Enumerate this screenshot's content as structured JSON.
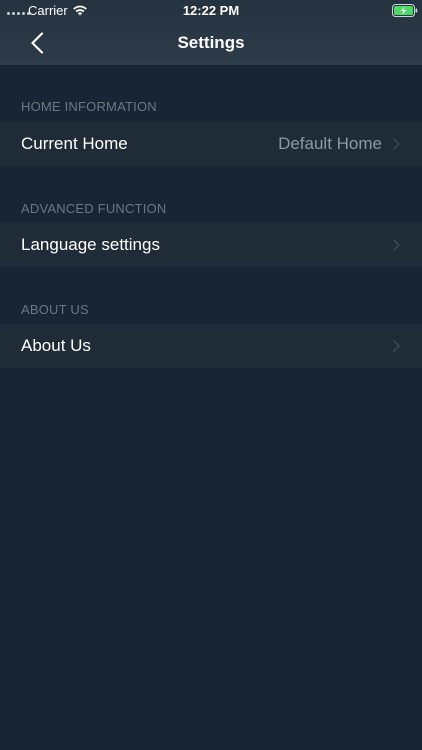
{
  "status_bar": {
    "carrier": "Carrier",
    "time": "12:22 PM",
    "signal_icon": "signal-dots-icon",
    "wifi_icon": "wifi-icon",
    "battery_icon": "battery-charging-icon",
    "battery_color": "#4cd964"
  },
  "nav_bar": {
    "title": "Settings",
    "back_icon": "chevron-left-icon"
  },
  "sections": [
    {
      "header": "HOME INFORMATION",
      "rows": [
        {
          "label": "Current Home",
          "value": "Default Home"
        }
      ]
    },
    {
      "header": "ADVANCED FUNCTION",
      "rows": [
        {
          "label": "Language settings",
          "value": ""
        }
      ]
    },
    {
      "header": "ABOUT US",
      "rows": [
        {
          "label": "About Us",
          "value": ""
        }
      ]
    }
  ],
  "colors": {
    "background": "#172534",
    "row_background": "#1f2c38",
    "header_text": "#6b7783",
    "value_text": "#8e989f",
    "chevron": "#3a4753"
  }
}
